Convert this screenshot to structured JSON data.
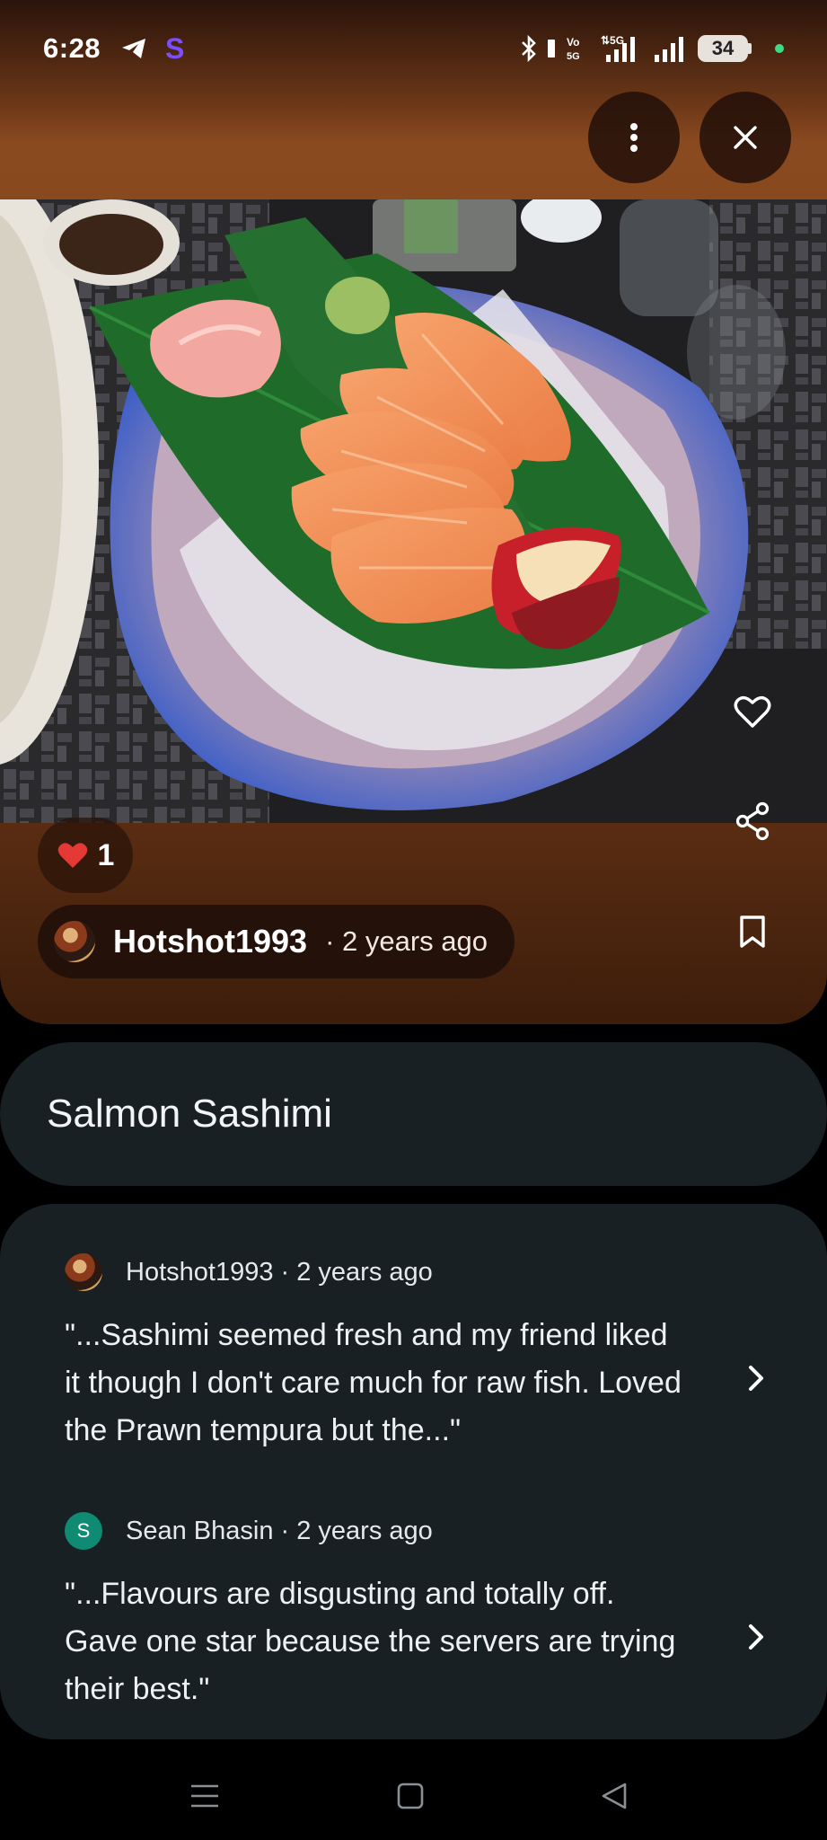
{
  "status_bar": {
    "time": "6:28",
    "battery": "34",
    "network": "5G"
  },
  "header_actions": {
    "more_icon": "more-vertical-icon",
    "close_icon": "close-icon"
  },
  "photo": {
    "description_icon": "food-photo"
  },
  "reactions": {
    "count": "1"
  },
  "author": {
    "name": "Hotshot1993",
    "time": "· 2 years ago"
  },
  "dish": {
    "title": "Salmon Sashimi"
  },
  "reviews": [
    {
      "author": "Hotshot1993",
      "meta": "Hotshot1993 · 2 years ago",
      "avatar_letter": "",
      "quote": "\"...Sashimi seemed fresh and my friend liked it though I don't care much for raw fish. Loved the Prawn tempura but the...\""
    },
    {
      "author": "Sean Bhasin",
      "meta": "Sean Bhasin · 2 years ago",
      "avatar_letter": "S",
      "quote": "\"...Flavours are disgusting and totally off. Gave one star because the servers are trying their best.\""
    }
  ],
  "colors": {
    "card_bg": "#182024",
    "accent_brown": "#7a3f1a",
    "avatar_green": "#0f8a73",
    "heart_red": "#e53935"
  }
}
